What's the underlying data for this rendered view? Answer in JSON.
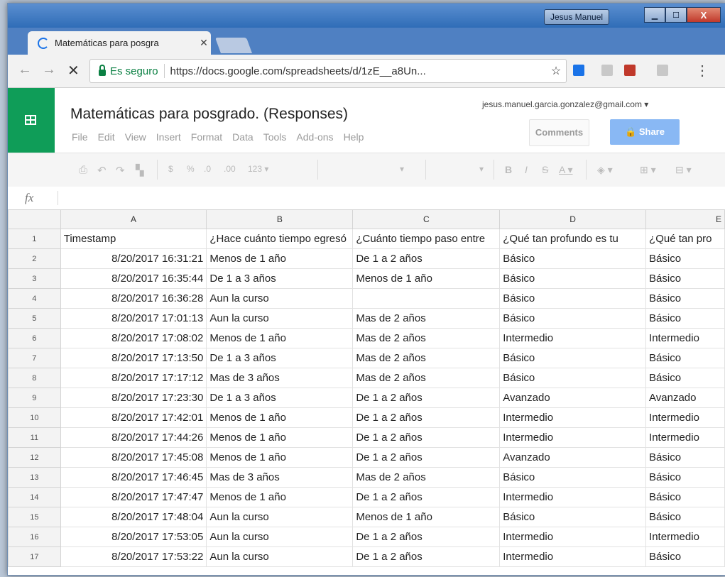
{
  "window": {
    "user": "Jesus Manuel",
    "minimize_glyph": "▁",
    "maximize_glyph": "☐",
    "close_glyph": "X"
  },
  "browser": {
    "tab_title": "Matemáticas para posgra",
    "tab_close_glyph": "✕",
    "back_glyph": "←",
    "forward_glyph": "→",
    "stop_glyph": "✕",
    "secure_label": "Es seguro",
    "url": "https://docs.google.com/spreadsheets/d/1zE__a8Un...",
    "star_glyph": "☆",
    "menu_glyph": "⋮"
  },
  "sheets": {
    "title": "Matemáticas para posgrado. (Responses)",
    "menu": [
      "File",
      "Edit",
      "View",
      "Insert",
      "Format",
      "Data",
      "Tools",
      "Add-ons",
      "Help"
    ],
    "account": "jesus.manuel.garcia.gonzalez@gmail.com ▾",
    "comments_label": "Comments",
    "share_label": "Share",
    "toolbar": {
      "print": "⎙",
      "undo": "↶",
      "redo": "↷",
      "paint": "▚",
      "currency": "$",
      "percent": "%",
      "dec_minus": ".0",
      "dec_plus": ".00",
      "num_format": "123 ▾",
      "dropdown1": "▾",
      "dropdown2": "▾",
      "bold": "B",
      "italic": "I",
      "strike": "S",
      "text_color": "A ▾",
      "fill": "◈ ▾",
      "borders": "⊞ ▾",
      "merge": "⊟ ▾"
    },
    "formula_label": "fx",
    "formula_value": ""
  },
  "grid": {
    "columns": [
      "A",
      "B",
      "C",
      "D",
      "E"
    ],
    "rows": [
      {
        "n": "1",
        "cells": [
          "Timestamp",
          "¿Hace cuánto tiempo egresó",
          "¿Cuánto tiempo paso entre",
          "¿Qué tan profundo es tu",
          "¿Qué tan pro"
        ]
      },
      {
        "n": "2",
        "cells": [
          "8/20/2017 16:31:21",
          "Menos de 1 año",
          "De 1 a 2 años",
          "Básico",
          "Básico"
        ]
      },
      {
        "n": "3",
        "cells": [
          "8/20/2017 16:35:44",
          "De 1 a 3 años",
          "Menos de 1 año",
          "Básico",
          "Básico"
        ]
      },
      {
        "n": "4",
        "cells": [
          "8/20/2017 16:36:28",
          "Aun la curso",
          "",
          "Básico",
          "Básico"
        ]
      },
      {
        "n": "5",
        "cells": [
          "8/20/2017 17:01:13",
          "Aun la curso",
          "Mas de 2 años",
          "Básico",
          "Básico"
        ]
      },
      {
        "n": "6",
        "cells": [
          "8/20/2017 17:08:02",
          "Menos de 1 año",
          "Mas de 2 años",
          "Intermedio",
          "Intermedio"
        ]
      },
      {
        "n": "7",
        "cells": [
          "8/20/2017 17:13:50",
          "De 1 a 3 años",
          "Mas de 2 años",
          "Básico",
          "Básico"
        ]
      },
      {
        "n": "8",
        "cells": [
          "8/20/2017 17:17:12",
          "Mas de 3 años",
          "Mas de 2 años",
          "Básico",
          "Básico"
        ]
      },
      {
        "n": "9",
        "cells": [
          "8/20/2017 17:23:30",
          "De 1 a 3 años",
          "De 1 a 2 años",
          "Avanzado",
          "Avanzado"
        ]
      },
      {
        "n": "10",
        "cells": [
          "8/20/2017 17:42:01",
          "Menos de 1 año",
          "De 1 a 2 años",
          "Intermedio",
          "Intermedio"
        ]
      },
      {
        "n": "11",
        "cells": [
          "8/20/2017 17:44:26",
          "Menos de 1 año",
          "De 1 a 2 años",
          "Intermedio",
          "Intermedio"
        ]
      },
      {
        "n": "12",
        "cells": [
          "8/20/2017 17:45:08",
          "Menos de 1 año",
          "De 1 a 2 años",
          "Avanzado",
          "Básico"
        ]
      },
      {
        "n": "13",
        "cells": [
          "8/20/2017 17:46:45",
          "Mas de 3 años",
          "Mas de 2 años",
          "Básico",
          "Básico"
        ]
      },
      {
        "n": "14",
        "cells": [
          "8/20/2017 17:47:47",
          "Menos de 1 año",
          "De 1 a 2 años",
          "Intermedio",
          "Básico"
        ]
      },
      {
        "n": "15",
        "cells": [
          "8/20/2017 17:48:04",
          "Aun la curso",
          "Menos de 1 año",
          "Básico",
          "Básico"
        ]
      },
      {
        "n": "16",
        "cells": [
          "8/20/2017 17:53:05",
          "Aun la curso",
          "De 1 a 2 años",
          "Intermedio",
          "Intermedio"
        ]
      },
      {
        "n": "17",
        "cells": [
          "8/20/2017 17:53:22",
          "Aun la curso",
          "De 1 a 2 años",
          "Intermedio",
          "Básico"
        ]
      }
    ]
  },
  "colors": {
    "sheets_green": "#0f9d58",
    "secure_green": "#0b8043",
    "share_blue": "#89b8f4"
  }
}
